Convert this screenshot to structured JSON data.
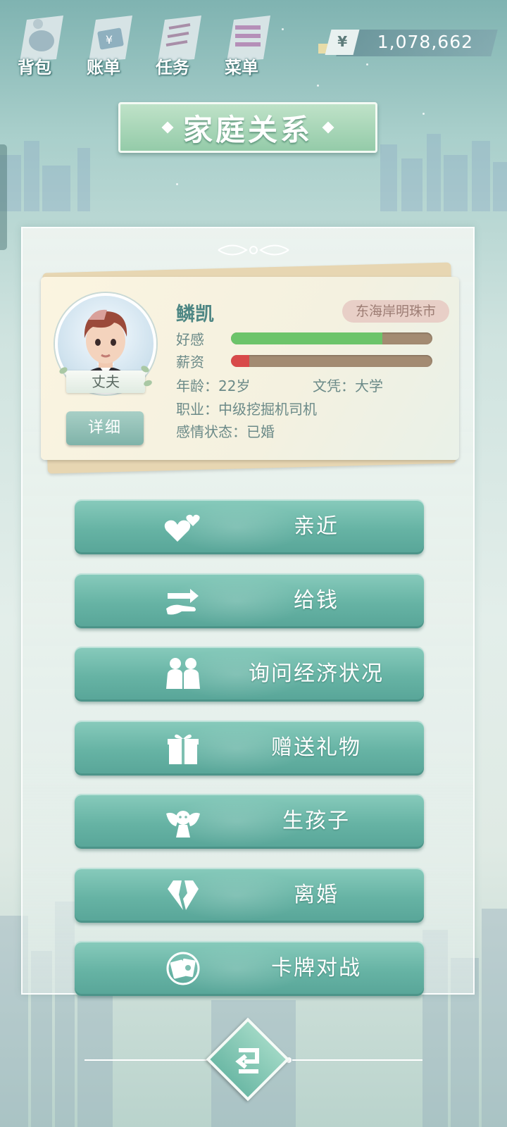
{
  "nav": {
    "items": [
      {
        "label": "背包",
        "icon": "backpack-icon"
      },
      {
        "label": "账单",
        "icon": "bill-icon"
      },
      {
        "label": "任务",
        "icon": "task-icon"
      },
      {
        "label": "菜单",
        "icon": "menu-icon"
      }
    ]
  },
  "currency": {
    "symbol": "¥",
    "value": "1,078,662"
  },
  "title": "家庭关系",
  "character": {
    "role": "丈夫",
    "name": "鳞凯",
    "location": "东海岸明珠市",
    "affection_label": "好感",
    "affection_level": 0.75,
    "salary_label": "薪资",
    "salary_level": 0.09,
    "age": "年龄：22岁",
    "education": "文凭：大学",
    "job": "职业：中级挖掘机司机",
    "relationship": "感情状态：已婚",
    "detail_button": "详细"
  },
  "actions": [
    {
      "label": "亲近",
      "icon": "hearts-icon"
    },
    {
      "label": "给钱",
      "icon": "give-money-icon"
    },
    {
      "label": "询问经济状况",
      "icon": "people-icon"
    },
    {
      "label": "赠送礼物",
      "icon": "gift-icon"
    },
    {
      "label": "生孩子",
      "icon": "angel-icon"
    },
    {
      "label": "离婚",
      "icon": "broken-diamond-icon"
    },
    {
      "label": "卡牌对战",
      "icon": "cards-icon"
    }
  ],
  "colors": {
    "affection_fill": "#6cc46a",
    "salary_fill": "#d84a4a",
    "button_teal": "#66b3a4",
    "name_color": "#4e8784"
  }
}
